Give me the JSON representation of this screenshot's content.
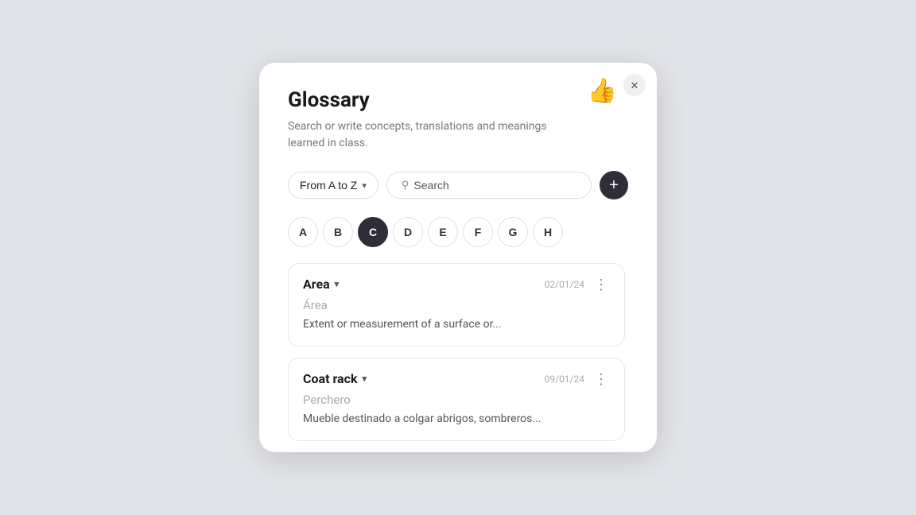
{
  "modal": {
    "title": "Glossary",
    "subtitle": "Search or write concepts, translations and meanings learned in class.",
    "close_label": "✕",
    "thumbs_emoji": "👍"
  },
  "toolbar": {
    "sort_label": "From A to Z",
    "search_placeholder": "Search",
    "add_label": "+"
  },
  "alpha_nav": {
    "letters": [
      "A",
      "B",
      "C",
      "D",
      "E",
      "F",
      "G",
      "H"
    ],
    "active": "C"
  },
  "entries": [
    {
      "term": "Area",
      "date": "02/01/24",
      "translation": "Área",
      "definition": "Extent or measurement of a surface or..."
    },
    {
      "term": "Coat rack",
      "date": "09/01/24",
      "translation": "Perchero",
      "definition": "Mueble destinado a colgar abrigos, sombreros..."
    }
  ]
}
